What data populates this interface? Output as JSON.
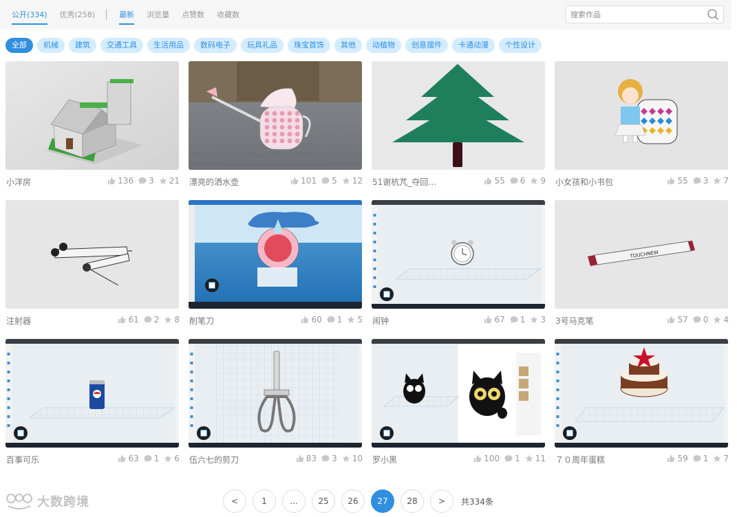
{
  "tabs": [
    {
      "label": "公开(334)",
      "active": true
    },
    {
      "label": "优秀(258)",
      "active": false
    },
    {
      "label": "最新",
      "active": true
    },
    {
      "label": "浏览量",
      "active": false
    },
    {
      "label": "点赞数",
      "active": false
    },
    {
      "label": "收藏数",
      "active": false
    }
  ],
  "search": {
    "placeholder": "搜索作品"
  },
  "categories": [
    "全部",
    "机械",
    "建筑",
    "交通工具",
    "生活用品",
    "数码电子",
    "玩具礼品",
    "珠宝首饰",
    "其他",
    "动植物",
    "创意摆件",
    "卡通动漫",
    "个性设计"
  ],
  "active_category": "全部",
  "works": [
    {
      "title": "小洋房",
      "likes": "136",
      "comments": "3",
      "stars": "21",
      "thumb": "house"
    },
    {
      "title": "漂亮的洒水壶",
      "likes": "101",
      "comments": "5",
      "stars": "12",
      "thumb": "can"
    },
    {
      "title": "51谢杭芃_夺回…",
      "likes": "55",
      "comments": "6",
      "stars": "9",
      "thumb": "tree"
    },
    {
      "title": "小女孩和小书包",
      "likes": "55",
      "comments": "3",
      "stars": "7",
      "thumb": "girl"
    },
    {
      "title": "注射器",
      "likes": "61",
      "comments": "2",
      "stars": "8",
      "thumb": "syringe"
    },
    {
      "title": "削笔刀",
      "likes": "60",
      "comments": "1",
      "stars": "5",
      "thumb": "sharpener"
    },
    {
      "title": "闹钟",
      "likes": "67",
      "comments": "1",
      "stars": "3",
      "thumb": "clock"
    },
    {
      "title": "3号马克笔",
      "likes": "57",
      "comments": "0",
      "stars": "4",
      "thumb": "marker"
    },
    {
      "title": "百事可乐",
      "likes": "63",
      "comments": "1",
      "stars": "6",
      "thumb": "pepsi"
    },
    {
      "title": "伍六七的剪刀",
      "likes": "83",
      "comments": "3",
      "stars": "10",
      "thumb": "scissors"
    },
    {
      "title": "罗小黑",
      "likes": "100",
      "comments": "1",
      "stars": "11",
      "thumb": "cat"
    },
    {
      "title": "７０周年蛋糕",
      "likes": "59",
      "comments": "1",
      "stars": "7",
      "thumb": "cake"
    }
  ],
  "thumb_text": {
    "marker_brand": "TOUCHNEW"
  },
  "pagination": {
    "prev": "<",
    "pages": [
      "1",
      "...",
      "25",
      "26",
      "27",
      "28"
    ],
    "current": "27",
    "next": ">",
    "total": "共334条"
  },
  "watermark": {
    "text": "大数跨境"
  },
  "colors": {
    "accent": "#2f8fe0",
    "chip_bg": "#d4ecff",
    "tree_green": "#1f7f5c"
  }
}
